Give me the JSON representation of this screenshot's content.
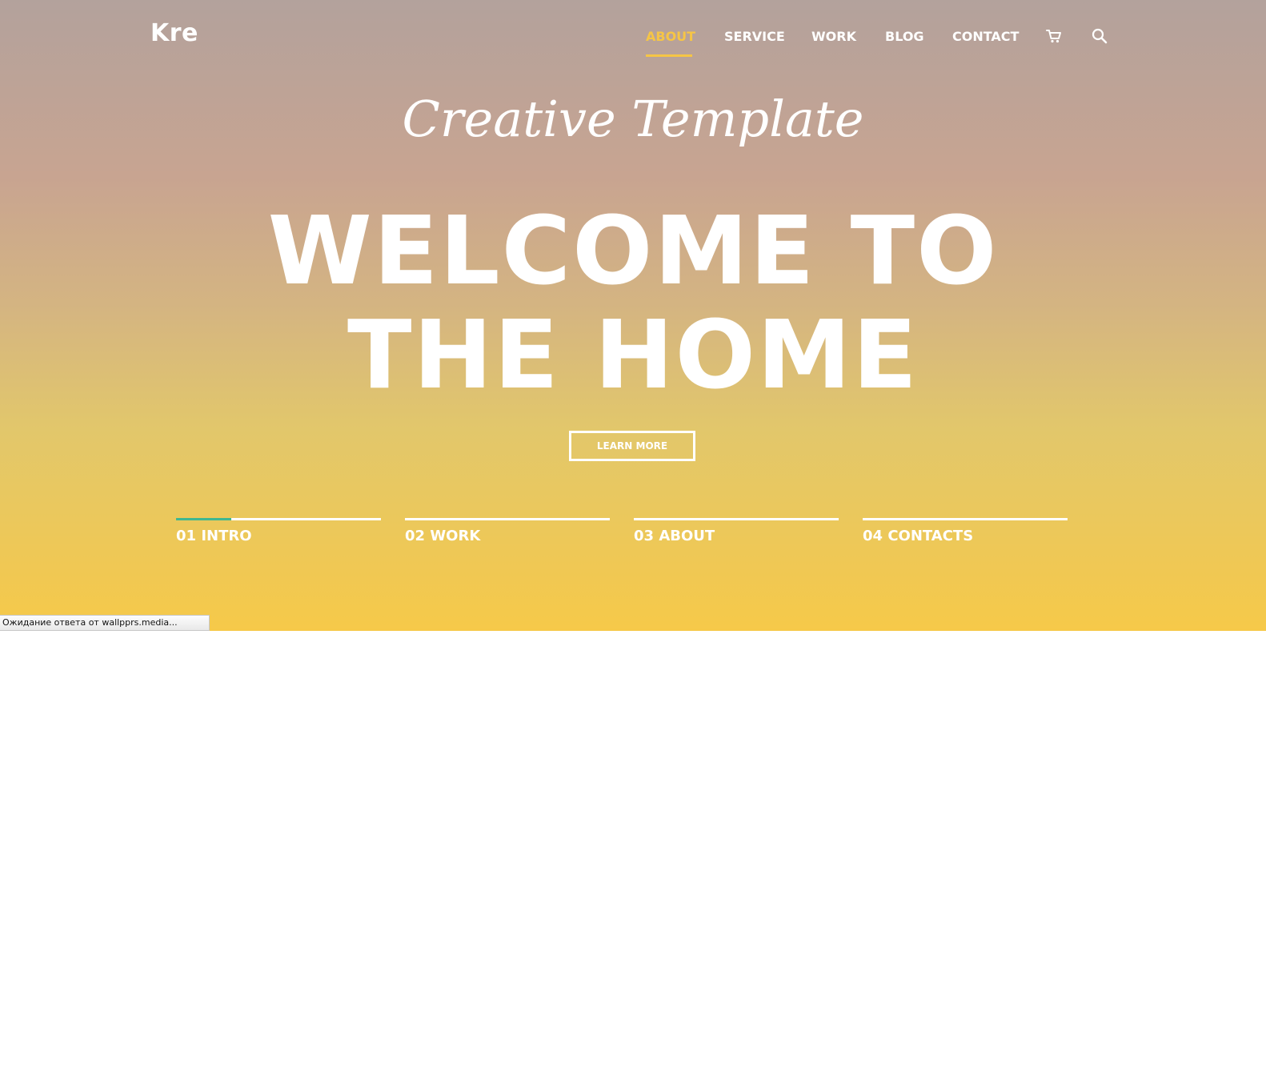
{
  "header": {
    "logo": "Kre",
    "nav": [
      {
        "label": "ABOUT",
        "active": true
      },
      {
        "label": "SERVICE",
        "active": false
      },
      {
        "label": "WORK",
        "active": false
      },
      {
        "label": "BLOG",
        "active": false
      },
      {
        "label": "CONTACT",
        "active": false
      }
    ],
    "icons": [
      "cart-icon",
      "search-icon"
    ]
  },
  "hero": {
    "script_title": "Creative Template",
    "headline_line1": "WELCOME TO",
    "headline_line2": "THE HOME",
    "cta_label": "LEARN MORE"
  },
  "sections": [
    {
      "label": "01 INTRO",
      "progress": 0.27
    },
    {
      "label": "02 WORK",
      "progress": 0
    },
    {
      "label": "03 ABOUT",
      "progress": 0
    },
    {
      "label": "04 CONTACTS",
      "progress": 0
    }
  ],
  "status_bar": {
    "text": "Ожидание ответа от wallpprs.media..."
  },
  "colors": {
    "accent": "#f6c545",
    "progress": "#3fb78f",
    "gradient_top": "#b3a29c",
    "gradient_bottom": "#f6c949"
  }
}
